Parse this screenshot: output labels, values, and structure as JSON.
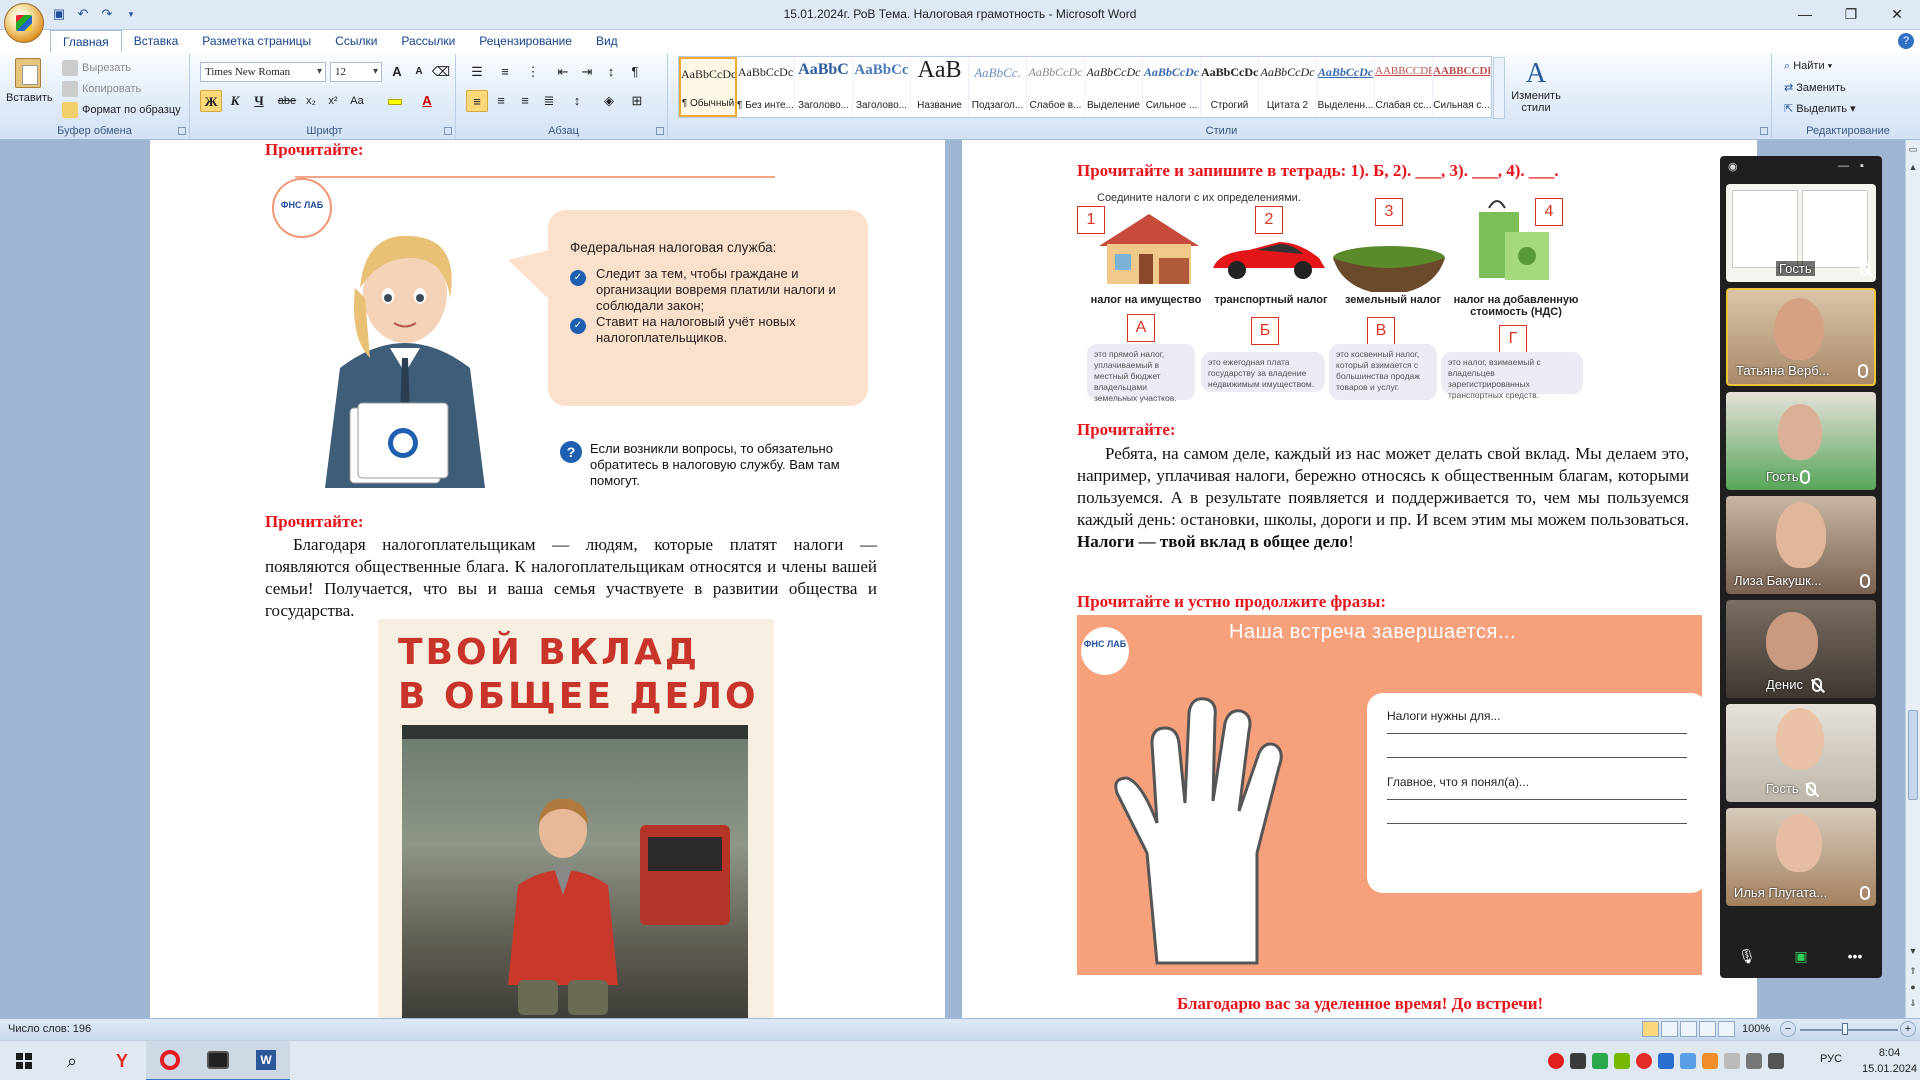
{
  "title_bar": {
    "title": "15.01.2024г. РоВ Тема. Налоговая грамотность - Microsoft Word",
    "minimize": "—",
    "restore": "❐",
    "close": "✕"
  },
  "ribbon_tabs": [
    "Главная",
    "Вставка",
    "Разметка страницы",
    "Ссылки",
    "Рассылки",
    "Рецензирование",
    "Вид"
  ],
  "clipboard": {
    "paste": "Вставить",
    "cut": "Вырезать",
    "copy": "Копировать",
    "format_painter": "Формат по образцу",
    "label": "Буфер обмена"
  },
  "font": {
    "family": "Times New Roman",
    "size": "12",
    "label": "Шрифт",
    "bold": "Ж",
    "italic": "К",
    "underline": "Ч",
    "strike": "abe",
    "subscript": "x₂",
    "superscript": "x²",
    "case": "Aa",
    "grow": "A",
    "shrink": "A"
  },
  "paragraph": {
    "label": "Абзац"
  },
  "styles": {
    "label": "Стили",
    "items": [
      {
        "sample": "AaBbCcDc",
        "name": "¶ Обычный"
      },
      {
        "sample": "AaBbCcDc",
        "name": "¶ Без инте..."
      },
      {
        "sample": "AaBbC",
        "name": "Заголово..."
      },
      {
        "sample": "AaBbCc",
        "name": "Заголово..."
      },
      {
        "sample": "AaB",
        "name": "Название"
      },
      {
        "sample": "AaBbCc.",
        "name": "Подзагол..."
      },
      {
        "sample": "AaBbCcDc",
        "name": "Слабое в..."
      },
      {
        "sample": "AaBbCcDc",
        "name": "Выделение"
      },
      {
        "sample": "AaBbCcDc",
        "name": "Сильное ..."
      },
      {
        "sample": "AaBbCcDc",
        "name": "Строгий"
      },
      {
        "sample": "AaBbCcDc",
        "name": "Цитата 2"
      },
      {
        "sample": "AaBbCcDc",
        "name": "Выделенн..."
      },
      {
        "sample": "AABBCCDE",
        "name": "Слабая сс..."
      },
      {
        "sample": "AABBCCDE",
        "name": "Сильная с..."
      }
    ],
    "change": "Изменить стили"
  },
  "editing": {
    "label": "Редактирование",
    "find": "Найти",
    "replace": "Заменить",
    "select": "Выделить"
  },
  "left_page": {
    "heading1": "Прочитайте:",
    "illustration": {
      "logo": "ФНС ЛАБ",
      "bubble_title": "Федеральная налоговая служба:",
      "bullet1": "Следит за тем, чтобы граждане и организации вовремя платили налоги и соблюдали закон;",
      "bullet2": "Ставит на налоговый учёт новых налогоплательщиков.",
      "question_mark": "?",
      "question": "Если возникли вопросы, то обязательно обратитесь в налоговую службу. Вам там помогут."
    },
    "heading2": "Прочитайте:",
    "paragraph": "Благодаря налогоплательщикам — людям, которые платят налоги — появляются общественные блага. К налогоплательщикам относятся и члены вашей семьи! Получается, что вы и ваша семья участвуете в развитии общества и государства.",
    "poster_line1": "ТВОЙ ВКЛАД",
    "poster_line2": "В ОБЩЕЕ ДЕЛО"
  },
  "right_page": {
    "heading1": "Прочитайте и запишите в тетрадь: 1). Б, 2). ___, 3). ___, 4). ___.",
    "match": {
      "caption": "Соедините налоги с их определениями.",
      "numbers": [
        "1",
        "2",
        "3",
        "4"
      ],
      "taxes": [
        "налог на имущество",
        "транспортный налог",
        "земельный налог",
        "налог на добавленную стоимость (НДС)"
      ],
      "letters": [
        "А",
        "Б",
        "В",
        "Г"
      ],
      "definitions": [
        "это прямой налог, уплачиваемый в местный бюджет владельцами земельных участков.",
        "это ежегодная плата государству за владение недвижимым имуществом.",
        "это косвенный налог, который взимается с большинства продаж товаров и услуг.",
        "это налог, взимаемый с владельцев зарегистрированных транспортных средств."
      ]
    },
    "heading2": "Прочитайте:",
    "paragraph_plain": "Ребята, на самом деле, каждый из нас может делать свой вклад. Мы делаем это, например, уплачивая налоги, бережно относясь к общественным благам, которыми пользуемся. А в результате появляется и поддерживается то, чем мы пользуемся каждый день: остановки, школы, дороги и пр. И всем этим мы можем пользоваться.",
    "paragraph_bold": "Налоги — твой вклад в общее дело",
    "paragraph_end": "!",
    "heading3": "Прочитайте и устно продолжите фразы:",
    "slide": {
      "logo": "ФНС ЛАБ",
      "title": "Наша встреча завершается...",
      "prompt1": "Налоги нужны для...",
      "prompt2": "Главное, что я понял(а)..."
    },
    "closing": "Благодарю вас за уделенное время! До встречи!"
  },
  "zoom": {
    "participants": [
      {
        "name": "Гость",
        "muted": true
      },
      {
        "name": "Татьяна Верб...",
        "muted": false,
        "active": true
      },
      {
        "name": "Гость",
        "muted": false
      },
      {
        "name": "Лиза Бакушк...",
        "muted": false
      },
      {
        "name": "Денис",
        "muted": true
      },
      {
        "name": "Гость",
        "muted": true
      },
      {
        "name": "Илья Плугата...",
        "muted": false
      }
    ]
  },
  "status_bar": {
    "word_count": "Число слов: 196",
    "zoom_level": "100%",
    "zoom_percent": 100
  },
  "taskbar": {
    "lang": "РУС",
    "time": "8:04",
    "date": "15.01.2024"
  },
  "colors": {
    "heading_red": "#e8141b",
    "ribbon_blue": "#15428b",
    "slide_peach": "#f6a07c",
    "bubble_peach": "#fbe0cc",
    "zoom_bg": "#1f1f1f"
  }
}
